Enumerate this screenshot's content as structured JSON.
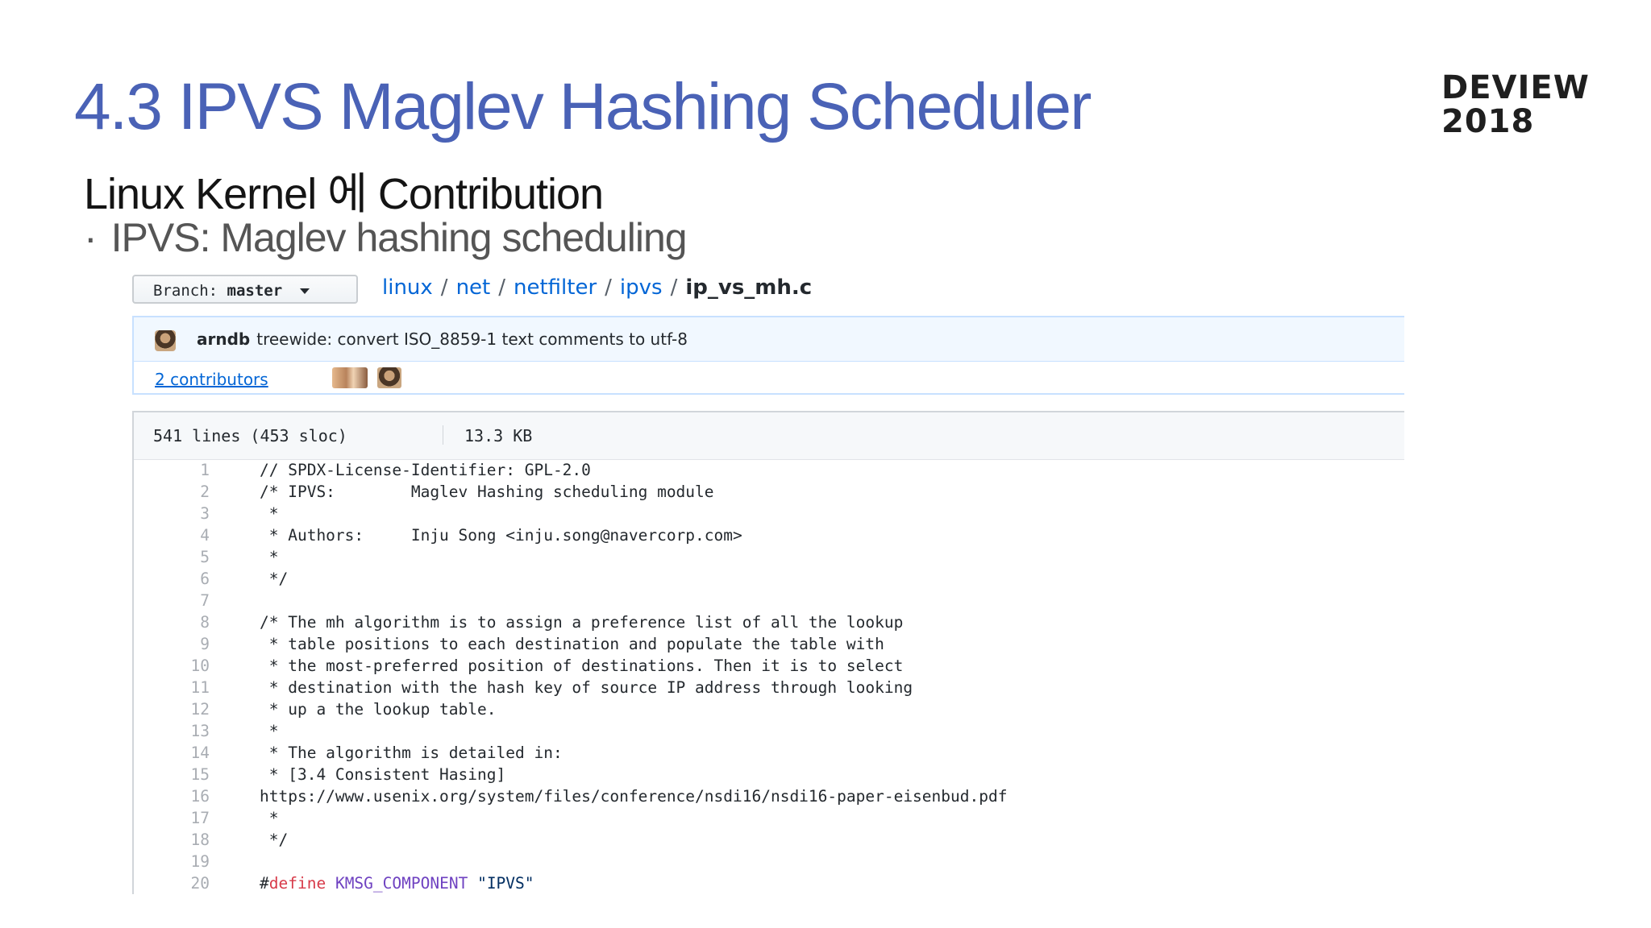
{
  "slide": {
    "title": "4.3 IPVS Maglev Hashing Scheduler",
    "logo_line1": "DEVIEW",
    "logo_line2": "2018",
    "subtitle": "Linux Kernel 에 Contribution",
    "bullet_marker": "·",
    "bullet": "IPVS: Maglev hashing scheduling"
  },
  "repo": {
    "branch_prefix": "Branch:",
    "branch_name": "master",
    "breadcrumb": [
      "linux",
      "net",
      "netfilter",
      "ipvs"
    ],
    "separator": "/",
    "file_name": "ip_vs_mh.c",
    "commit_author": "arndb",
    "commit_message": "treewide: convert ISO_8859-1 text comments to utf-8",
    "contributors": "2 contributors",
    "file_lines": "541 lines (453 sloc)",
    "file_size": "13.3 KB"
  },
  "code_lines": [
    "// SPDX-License-Identifier: GPL-2.0",
    "/* IPVS:        Maglev Hashing scheduling module",
    " *",
    " * Authors:     Inju Song <inju.song@navercorp.com>",
    " *",
    " */",
    "",
    "/* The mh algorithm is to assign a preference list of all the lookup",
    " * table positions to each destination and populate the table with",
    " * the most-preferred position of destinations. Then it is to select",
    " * destination with the hash key of source IP address through looking",
    " * up a the lookup table.",
    " *",
    " * The algorithm is detailed in:",
    " * [3.4 Consistent Hasing]",
    "https://www.usenix.org/system/files/conference/nsdi16/nsdi16-paper-eisenbud.pdf",
    " *",
    " */",
    "",
    ""
  ],
  "line_numbers": [
    "1",
    "2",
    "3",
    "4",
    "5",
    "6",
    "7",
    "8",
    "9",
    "10",
    "11",
    "12",
    "13",
    "14",
    "15",
    "16",
    "17",
    "18",
    "19",
    "20"
  ],
  "define_line": {
    "hash": "#",
    "keyword": "define",
    "identifier": "KMSG_COMPONENT",
    "value": "\"IPVS\""
  },
  "colors": {
    "title": "#4a62b6",
    "link": "#0366d6",
    "keyword": "#d73a49",
    "identifier": "#6f42c1",
    "commit_bg": "#f1f8ff"
  }
}
